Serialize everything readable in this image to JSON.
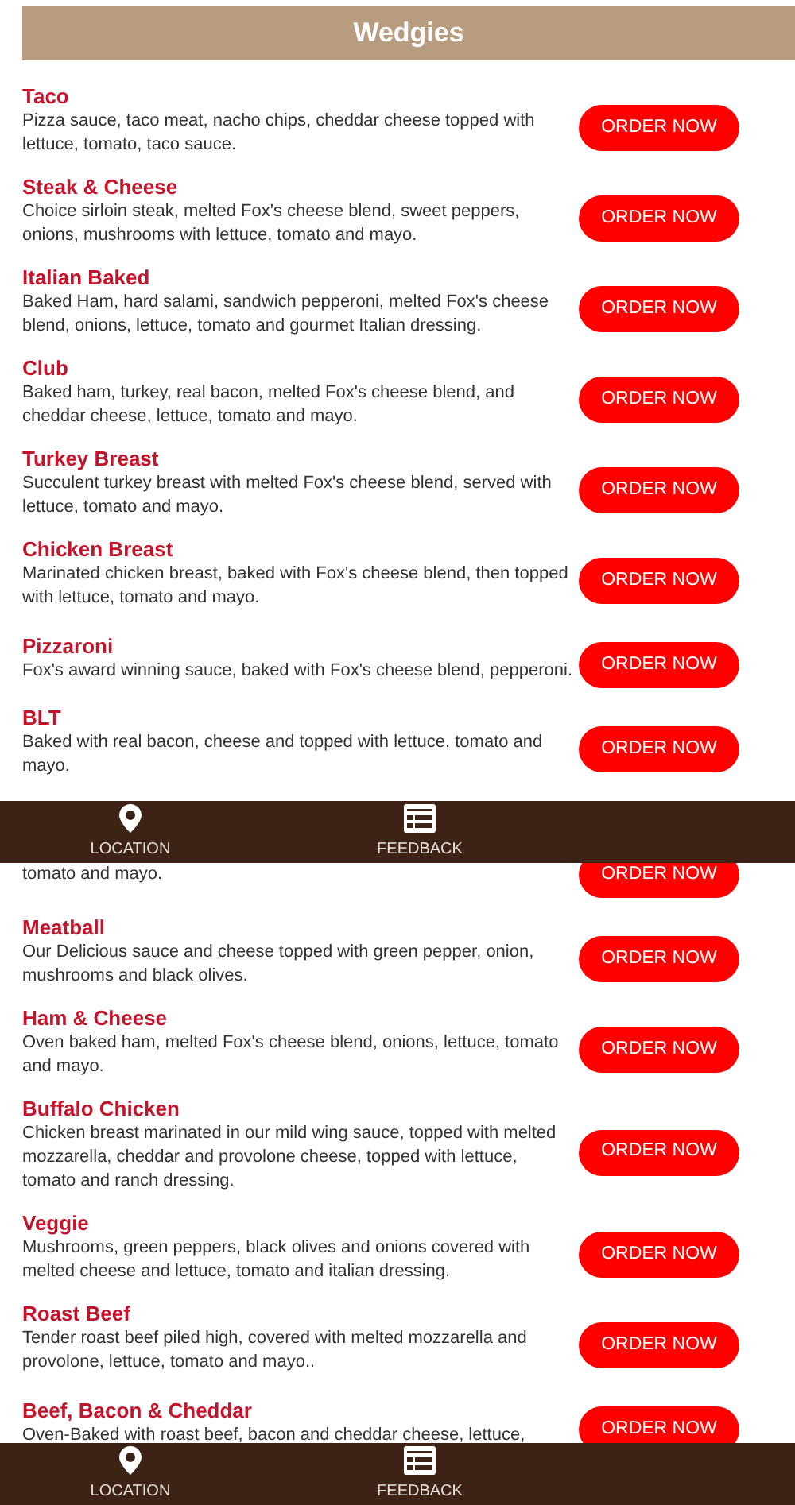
{
  "screens": [
    {
      "header": {
        "title": "Wedgies"
      },
      "items": [
        {
          "name": "Taco",
          "description": "Pizza sauce, taco meat, nacho chips, cheddar cheese topped with lettuce, tomato, taco sauce.",
          "button": "ORDER NOW"
        },
        {
          "name": "Steak & Cheese",
          "description": "Choice sirloin steak, melted Fox's cheese blend, sweet peppers, onions, mushrooms with lettuce, tomato and mayo.",
          "button": "ORDER NOW"
        },
        {
          "name": "Italian Baked",
          "description": "Baked Ham, hard salami, sandwich pepperoni, melted Fox's cheese blend, onions, lettuce, tomato and gourmet Italian dressing.",
          "button": "ORDER NOW"
        },
        {
          "name": "Club",
          "description": "Baked ham, turkey, real bacon, melted Fox's cheese blend, and cheddar cheese, lettuce, tomato and mayo.",
          "button": "ORDER NOW"
        },
        {
          "name": "Turkey Breast",
          "description": "Succulent turkey breast with melted Fox's cheese blend, served with lettuce, tomato and mayo.",
          "button": "ORDER NOW"
        },
        {
          "name": "Chicken Breast",
          "description": "Marinated chicken breast, baked with Fox's cheese blend, then topped with lettuce, tomato and mayo.",
          "button": "ORDER NOW"
        },
        {
          "name": "Pizzaroni",
          "description": "Fox's award winning sauce, baked with Fox's cheese blend, pepperoni.",
          "button": "ORDER NOW"
        },
        {
          "name": "BLT",
          "description": "Baked with real bacon, cheese and topped with lettuce, tomato and mayo.",
          "button": "ORDER NOW"
        }
      ],
      "nav": [
        {
          "kind": "location",
          "label": "LOCATION"
        },
        {
          "kind": "feedback",
          "label": "FEEDBACK"
        }
      ]
    },
    {
      "items": [
        {
          "description": "tomato and mayo.",
          "button": "ORDER NOW"
        },
        {
          "name": "Meatball",
          "description": "Our Delicious sauce and cheese topped with green pepper, onion, mushrooms and black olives.",
          "button": "ORDER NOW"
        },
        {
          "name": "Ham & Cheese",
          "description": "Oven baked ham, melted Fox's cheese blend, onions, lettuce, tomato and mayo.",
          "button": "ORDER NOW"
        },
        {
          "name": "Buffalo Chicken",
          "description": "Chicken breast marinated in our mild wing sauce, topped with melted mozzarella, cheddar and provolone cheese, topped with lettuce, tomato and ranch dressing.",
          "button": "ORDER NOW"
        },
        {
          "name": "Veggie",
          "description": "Mushrooms, green peppers, black olives and onions covered with melted cheese and lettuce, tomato and italian dressing.",
          "button": "ORDER NOW"
        },
        {
          "name": "Roast Beef",
          "description": "Tender roast beef piled high, covered with melted mozzarella and provolone, lettuce, tomato and mayo..",
          "button": "ORDER NOW"
        },
        {
          "name": "Beef, Bacon & Cheddar",
          "description": "Oven-Baked with roast beef, bacon and cheddar cheese, lettuce,",
          "button": "ORDER NOW"
        }
      ],
      "nav": [
        {
          "kind": "location",
          "label": "LOCATION"
        },
        {
          "kind": "feedback",
          "label": "FEEDBACK"
        }
      ]
    }
  ]
}
